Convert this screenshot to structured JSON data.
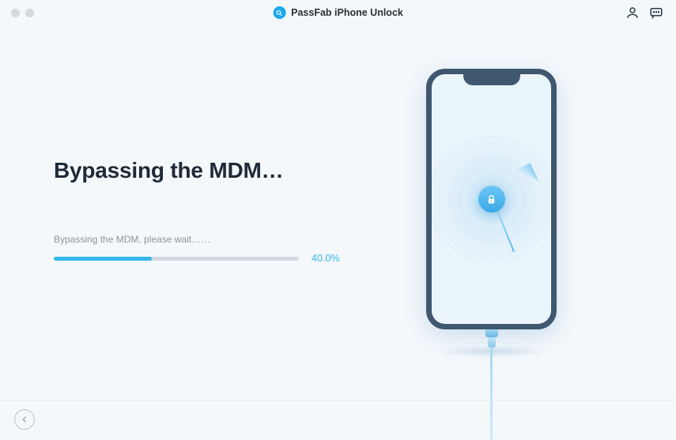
{
  "app": {
    "title": "PassFab iPhone Unlock"
  },
  "main": {
    "heading": "Bypassing the MDM…",
    "status_text": "Bypassing the MDM, please wait……",
    "progress_pct_text": "40.0%",
    "progress_pct_value": 40.0
  },
  "icons": {
    "account": "user-icon",
    "support": "chat-icon",
    "back": "back-arrow-icon",
    "lock": "lock-icon",
    "logo": "passfab-logo"
  },
  "colors": {
    "accent": "#34b6e8",
    "heading": "#1e2a38",
    "muted": "#8a94a0",
    "phone_frame": "#3f5870"
  }
}
